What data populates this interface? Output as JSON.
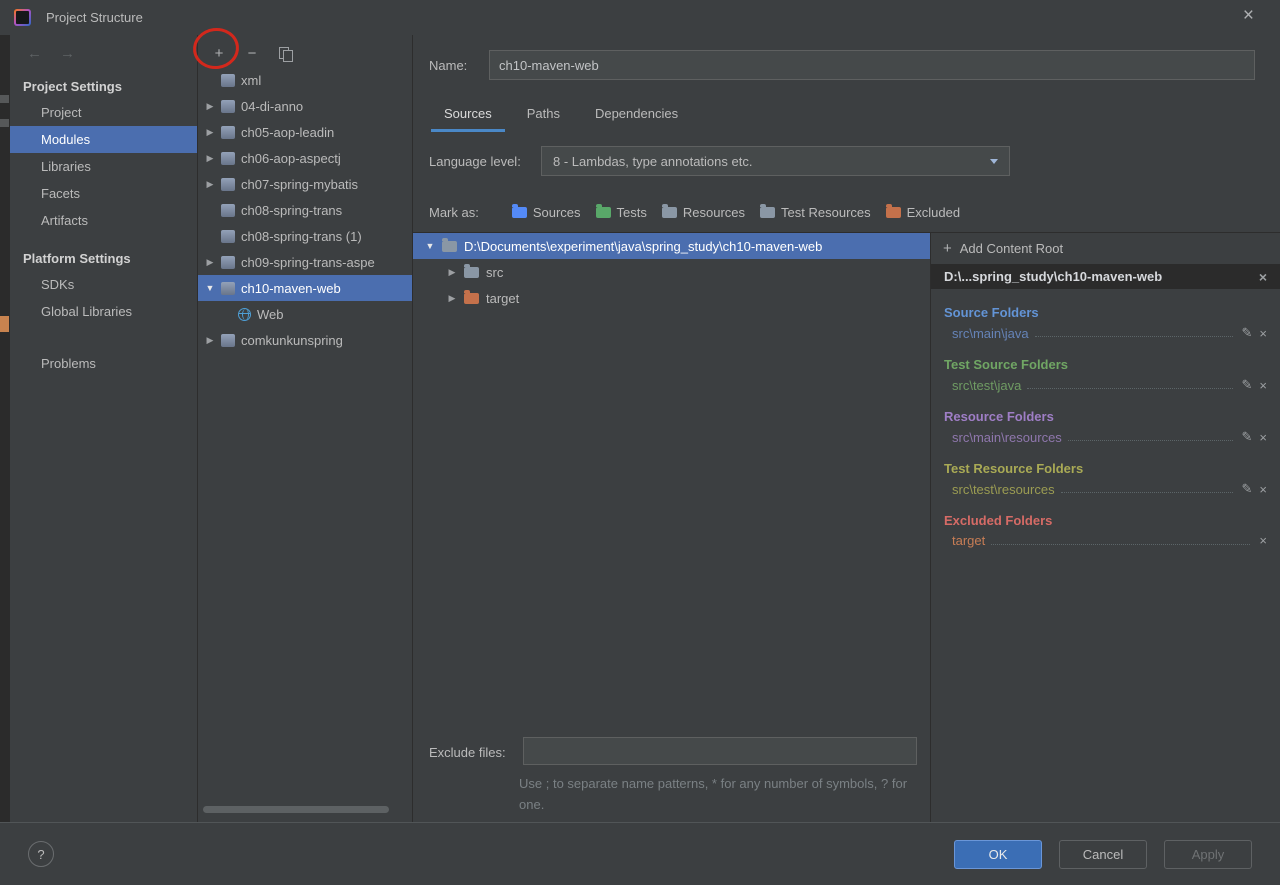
{
  "colors": {
    "selection_blue": "#4b6eaf",
    "tab_underline": "#4a88c7",
    "annotation_red": "#d3281c",
    "ok_button_blue": "#3b6eb5",
    "source_folder_blue": "#6394d6",
    "test_folder_green": "#70a664",
    "resource_folder_violet": "#9f7ec6",
    "test_resource_olive": "#a9aa55",
    "excluded_red": "#d66b66",
    "excluded_target_orange": "#c77d55"
  },
  "icons": {
    "close": "×",
    "add": "+",
    "remove": "−",
    "back": "←",
    "forward": "→",
    "collapsed": "▶",
    "expanded": "▼",
    "edit": "✎"
  },
  "titlebar": {
    "title": "Project Structure"
  },
  "sidebar": {
    "sections": [
      {
        "header": "Project Settings",
        "items": [
          {
            "label": "Project"
          },
          {
            "label": "Modules"
          },
          {
            "label": "Libraries"
          },
          {
            "label": "Facets"
          },
          {
            "label": "Artifacts"
          }
        ]
      },
      {
        "header": "Platform Settings",
        "items": [
          {
            "label": "SDKs"
          },
          {
            "label": "Global Libraries"
          }
        ]
      }
    ],
    "problems": "Problems",
    "selected_item": "Modules"
  },
  "module_list": {
    "items": [
      {
        "label": "xml"
      },
      {
        "label": "04-di-anno"
      },
      {
        "label": "ch05-aop-leadin"
      },
      {
        "label": "ch06-aop-aspectj"
      },
      {
        "label": "ch07-spring-mybatis"
      },
      {
        "label": "ch08-spring-trans"
      },
      {
        "label": "ch08-spring-trans (1)"
      },
      {
        "label": "ch09-spring-trans-aspe"
      },
      {
        "label": "ch10-maven-web"
      },
      {
        "label": "Web"
      },
      {
        "label": "comkunkunspring"
      }
    ],
    "selected_item": "ch10-maven-web"
  },
  "editor": {
    "name_label": "Name:",
    "name_value": "ch10-maven-web",
    "tabs": [
      {
        "label": "Sources"
      },
      {
        "label": "Paths"
      },
      {
        "label": "Dependencies"
      }
    ],
    "selected_tab": "Sources",
    "language_level_label": "Language level:",
    "language_level_value": "8 - Lambdas, type annotations etc.",
    "mark_as_label": "Mark as:",
    "mark_as": [
      {
        "label": "Sources"
      },
      {
        "label": "Tests"
      },
      {
        "label": "Resources"
      },
      {
        "label": "Test Resources"
      },
      {
        "label": "Excluded"
      }
    ],
    "content_tree": {
      "root": "D:\\Documents\\experiment\\java\\spring_study\\ch10-maven-web",
      "children": [
        {
          "label": "src"
        },
        {
          "label": "target"
        }
      ]
    },
    "exclude_files_label": "Exclude files:",
    "exclude_files_value": "",
    "hint": "Use ; to separate name patterns, * for any number of symbols, ? for one."
  },
  "content_roots": {
    "add_label": "Add Content Root",
    "root_path": "D:\\...spring_study\\ch10-maven-web",
    "sections": [
      {
        "header": "Source Folders",
        "items": [
          {
            "path": "src\\main\\java"
          }
        ]
      },
      {
        "header": "Test Source Folders",
        "items": [
          {
            "path": "src\\test\\java"
          }
        ]
      },
      {
        "header": "Resource Folders",
        "items": [
          {
            "path": "src\\main\\resources"
          }
        ]
      },
      {
        "header": "Test Resource Folders",
        "items": [
          {
            "path": "src\\test\\resources"
          }
        ]
      },
      {
        "header": "Excluded Folders",
        "items": [
          {
            "path": "target"
          }
        ]
      }
    ]
  },
  "footer": {
    "help": "?",
    "ok": "OK",
    "cancel": "Cancel",
    "apply": "Apply"
  },
  "annotation": {
    "shape": "ellipse",
    "color": "#d3281c",
    "target": "add-module-button"
  }
}
